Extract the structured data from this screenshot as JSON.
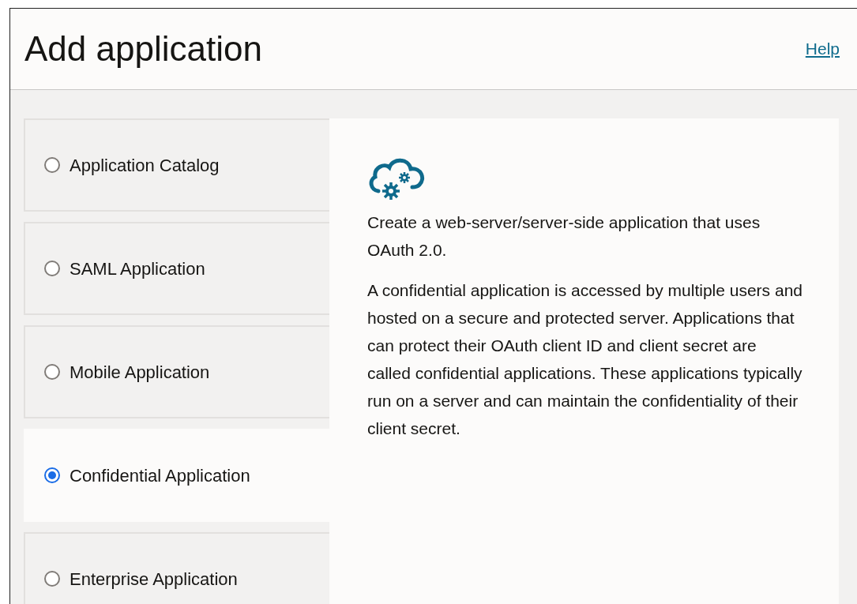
{
  "page": {
    "title": "Add application",
    "help_link": "Help"
  },
  "options": [
    {
      "label": "Application Catalog",
      "selected": false
    },
    {
      "label": "SAML Application",
      "selected": false
    },
    {
      "label": "Mobile Application",
      "selected": false
    },
    {
      "label": "Confidential Application",
      "selected": true
    },
    {
      "label": "Enterprise Application",
      "selected": false
    }
  ],
  "detail": {
    "summary": "Create a web-server/server-side application that uses OAuth 2.0.",
    "description": "A confidential application is accessed by multiple users and hosted on a secure and protected server. Applications that can protect their OAuth client ID and client secret are called confidential applications. These applications typically run on a server and can maintain the confidentiality of their client secret."
  }
}
